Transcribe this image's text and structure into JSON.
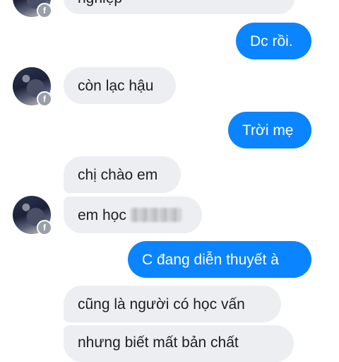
{
  "conversation": {
    "messages": [
      {
        "side": "incoming",
        "text": "nghiệp",
        "partial": true
      },
      {
        "side": "outgoing",
        "text": "Dc rồi."
      },
      {
        "side": "incoming",
        "text": "còn lạc hậu"
      },
      {
        "side": "outgoing",
        "text": "Trời mẹ"
      },
      {
        "side": "incoming",
        "text": "chị chào em"
      },
      {
        "side": "incoming",
        "text": "em học",
        "has_blurred_text": true
      },
      {
        "side": "outgoing",
        "text": "C đang diễn thuyết à"
      },
      {
        "side": "incoming",
        "text": "cũng là người có học vấn"
      },
      {
        "side": "incoming",
        "text": "nhưng biết mất bản chất",
        "partial": true
      }
    ]
  },
  "avatar": {
    "icon": "facebook-badge-icon",
    "badge_glyph": "f"
  },
  "colors": {
    "outgoing_bubble": "#0a84ff",
    "incoming_bubble": "#eceef1",
    "incoming_text": "#1c1e21",
    "outgoing_text": "#ffffff",
    "background": "#ffffff"
  }
}
